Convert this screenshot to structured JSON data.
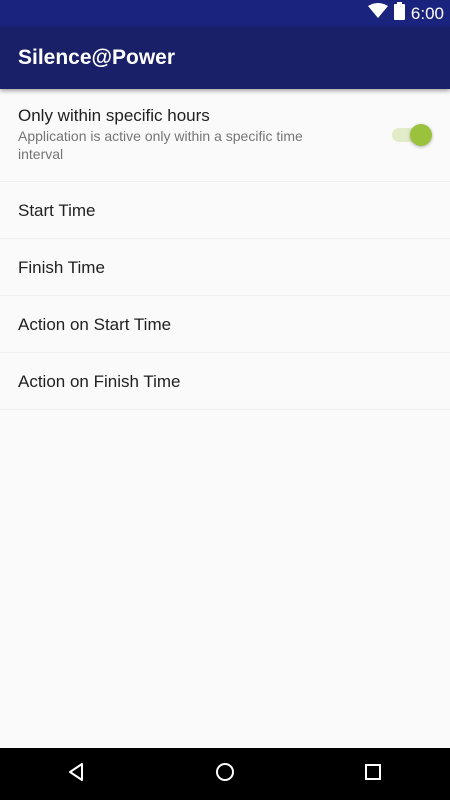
{
  "status_bar": {
    "time": "6:00",
    "icons": [
      "wifi-icon",
      "battery-icon"
    ]
  },
  "app_bar": {
    "title": "Silence@Power"
  },
  "preferences": {
    "within_hours": {
      "title": "Only within specific hours",
      "summary": "Application is active only within a specific time interval",
      "enabled": true
    },
    "start_time": {
      "title": "Start Time"
    },
    "finish_time": {
      "title": "Finish Time"
    },
    "action_on_start": {
      "title": "Action on Start Time"
    },
    "action_on_finish": {
      "title": "Action on Finish Time"
    }
  },
  "nav_bar": {
    "buttons": [
      "back-icon",
      "home-icon",
      "recents-icon"
    ]
  },
  "colors": {
    "status_bar": "#1a237e",
    "app_bar": "#1a2068",
    "accent": "#9bc23c",
    "background": "#fafafa"
  }
}
